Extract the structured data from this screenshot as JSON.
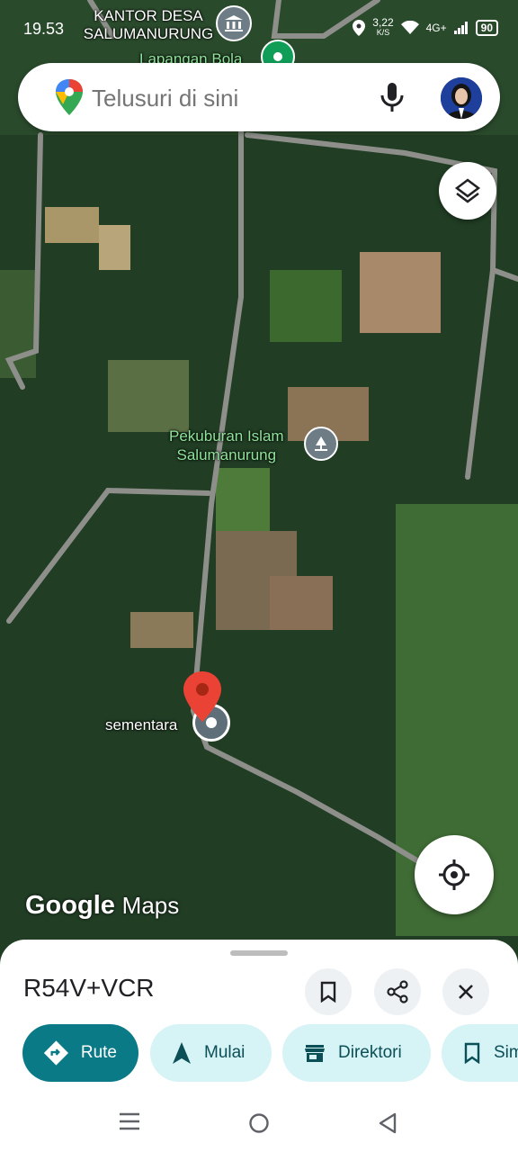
{
  "status_bar": {
    "time": "19.53",
    "net_speed": "3,22",
    "net_unit": "K/S",
    "signal": "4G+",
    "battery": "90"
  },
  "search": {
    "placeholder": "Telusuri di sini"
  },
  "map_labels": {
    "office": "KANTOR DESA SALUMANURUNG",
    "field": "Lapangan Bola",
    "cemetery_line1": "Pekuburan Islam",
    "cemetery_line2": "Salumanurung",
    "pin_label": "sementara"
  },
  "logo": {
    "brand": "Google",
    "product": "Maps"
  },
  "place": {
    "plus_code": "R54V+VCR"
  },
  "actions": {
    "route": "Rute",
    "start": "Mulai",
    "directory": "Direktori",
    "save": "Simpan"
  },
  "icons": [
    "google-maps-pin-icon",
    "mic-icon",
    "layers-icon",
    "my-location-icon",
    "bookmark-icon",
    "share-icon",
    "close-icon",
    "directions-icon",
    "navigation-arrow-icon",
    "store-icon",
    "menu-icon",
    "home-circle-icon",
    "back-triangle-icon"
  ],
  "colors": {
    "primary_chip": "#0b7a87",
    "secondary_chip": "#d6f3f6",
    "pin": "#ea4335"
  }
}
